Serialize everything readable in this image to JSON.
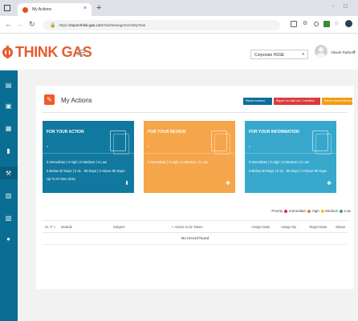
{
  "browser": {
    "tab_title": "My Actions",
    "tab_close": "×",
    "new_tab": "+",
    "minimize": "-",
    "maximize": "□",
    "url_scheme": "https://",
    "url_host": "report.think-gas.com",
    "url_path": "/TaskManagement/MyTask"
  },
  "header": {
    "logo_text": "THINK GAS",
    "select_value": "Corporate HSSE",
    "user_name": "Vikash Rathore"
  },
  "page": {
    "title": "My Actions",
    "buttons": {
      "report_incident": "Report Incident",
      "report_unsafe": "Report Un-Safe Act / Condition",
      "report_issues": "Report Issues/Observations"
    }
  },
  "cards": {
    "action": {
      "heading": "FOR YOUR ACTION",
      "dash": "-",
      "line1": "0 Immediate | 0 High | 0 Medium | 0 Low",
      "line2": "0 Below 30 Days | 0 31 - 90 Days | 0 Above 90 Days -",
      "line3": "Up To 07-Dec-2021"
    },
    "review": {
      "heading": "FOR YOUR REVIEW",
      "dash": "-",
      "line1": "0 Immediate | 0 High | 0 Medium | 0 Low"
    },
    "info": {
      "heading": "FOR YOUR INFORMATION",
      "dash": "-",
      "line1": "0 Immediate | 0 High | 0 Medium | 0 Low",
      "line2": "0 Below 30 Days | 0 31 - 90 Days | 0 Above 90 Days"
    }
  },
  "priority": {
    "label": "Priority",
    "immediate": "Immediate",
    "high": "High",
    "medium": "Medium",
    "low": "Low",
    "colors": {
      "immediate": "#d9285a",
      "high": "#e67e22",
      "medium": "#f1c40f",
      "low": "#27ae60"
    }
  },
  "table": {
    "columns": [
      "Sr. #",
      "Module",
      "Subject",
      "Action to be Taken",
      "Assign Date",
      "Assign By",
      "Target Date",
      "Status"
    ],
    "empty_text": "No record found"
  },
  "colors": {
    "brand": "#e65c2f",
    "sidebar": "#0a6e94"
  }
}
